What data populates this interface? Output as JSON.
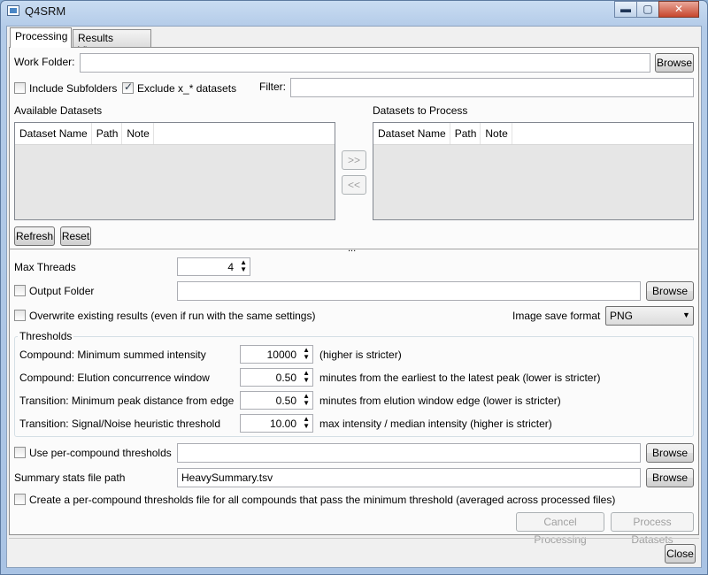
{
  "window": {
    "title": "Q4SRM",
    "minimize": "▬",
    "maximize": "▢",
    "close": "✕"
  },
  "tabs": [
    "Processing",
    "Results Viewer"
  ],
  "work_folder": {
    "label": "Work Folder:",
    "value": "",
    "browse": "Browse"
  },
  "include_subfolders": {
    "label": "Include Subfolders",
    "checked": false
  },
  "exclude_x": {
    "label": "Exclude x_* datasets",
    "checked": true
  },
  "filter": {
    "label": "Filter:",
    "value": ""
  },
  "available": {
    "title": "Available Datasets",
    "columns": [
      "Dataset Name",
      "Path",
      "Note"
    ]
  },
  "to_process": {
    "title": "Datasets to Process",
    "columns": [
      "Dataset Name",
      "Path",
      "Note"
    ]
  },
  "move_right": ">>",
  "move_left": "<<",
  "refresh": "Refresh",
  "reset": "Reset",
  "splitter": "...",
  "max_threads": {
    "label": "Max Threads",
    "value": "4"
  },
  "output_folder": {
    "label": "Output Folder",
    "value": "",
    "browse": "Browse"
  },
  "overwrite": {
    "label": "Overwrite existing results (even if run with the same settings)"
  },
  "image_format": {
    "label": "Image save format",
    "value": "PNG"
  },
  "thresholds": {
    "title": "Thresholds",
    "rows": [
      {
        "label": "Compound: Minimum summed intensity",
        "value": "10000",
        "note": "(higher is stricter)"
      },
      {
        "label": "Compound: Elution concurrence window",
        "value": "0.50",
        "note": "minutes from the earliest to the latest peak (lower is stricter)"
      },
      {
        "label": "Transition: Minimum peak distance from edge",
        "value": "0.50",
        "note": "minutes from elution window edge (lower is stricter)"
      },
      {
        "label": "Transition: Signal/Noise heuristic threshold",
        "value": "10.00",
        "note": "max intensity / median intensity (higher is stricter)"
      }
    ]
  },
  "per_compound": {
    "label": "Use per-compound thresholds",
    "value": "",
    "browse": "Browse"
  },
  "summary": {
    "label": "Summary stats file path",
    "value": "HeavySummary.tsv",
    "browse": "Browse"
  },
  "create_file": {
    "label": "Create a per-compound thresholds file for all compounds that pass the minimum threshold (averaged across processed files)"
  },
  "cancel_processing": "Cancel Processing",
  "process_datasets": "Process Datasets",
  "close": "Close"
}
